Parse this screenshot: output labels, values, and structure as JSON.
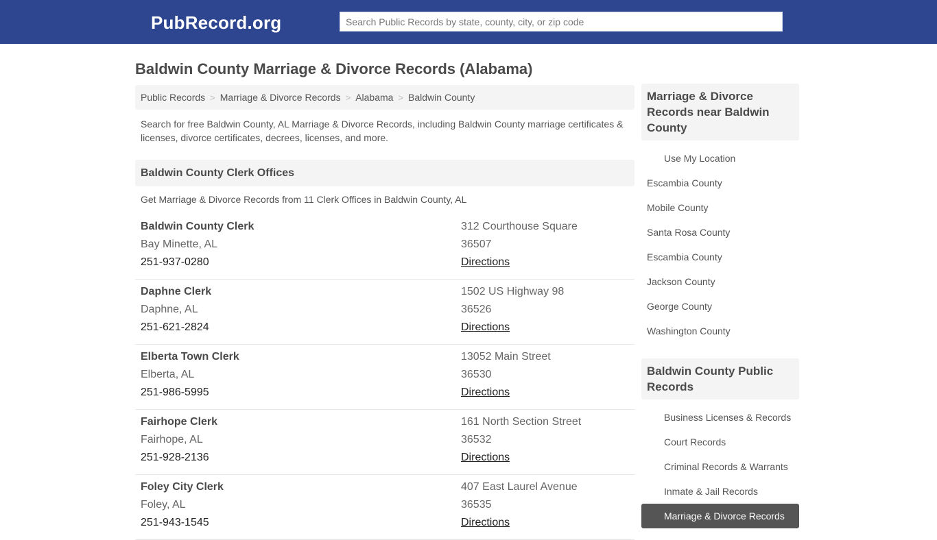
{
  "header": {
    "logo": "PubRecord.org",
    "search_placeholder": "Search Public Records by state, county, city, or zip code",
    "search_value": "",
    "bg_color": "#2e4690"
  },
  "page": {
    "title": "Baldwin County Marriage & Divorce Records (Alabama)",
    "breadcrumb": [
      {
        "label": "Public Records"
      },
      {
        "label": "Marriage & Divorce Records"
      },
      {
        "label": "Alabama"
      },
      {
        "label": "Baldwin County"
      }
    ],
    "breadcrumb_separator": ">",
    "intro": "Search for free Baldwin County, AL Marriage & Divorce Records, including Baldwin County marriage certificates & licenses, divorce certificates, decrees, licenses, and more.",
    "section_title": "Baldwin County Clerk Offices",
    "section_subtitle": "Get Marriage & Divorce Records from 11 Clerk Offices in Baldwin County, AL"
  },
  "offices": [
    {
      "name": "Baldwin County Clerk",
      "city": "Bay Minette, AL",
      "phone": "251-937-0280",
      "address": "312 Courthouse Square",
      "zip": "36507",
      "directions": "Directions"
    },
    {
      "name": "Daphne Clerk",
      "city": "Daphne, AL",
      "phone": "251-621-2824",
      "address": "1502 US Highway 98",
      "zip": "36526",
      "directions": "Directions"
    },
    {
      "name": "Elberta Town Clerk",
      "city": "Elberta, AL",
      "phone": "251-986-5995",
      "address": "13052 Main Street",
      "zip": "36530",
      "directions": "Directions"
    },
    {
      "name": "Fairhope Clerk",
      "city": "Fairhope, AL",
      "phone": "251-928-2136",
      "address": "161 North Section Street",
      "zip": "36532",
      "directions": "Directions"
    },
    {
      "name": "Foley City Clerk",
      "city": "Foley, AL",
      "phone": "251-943-1545",
      "address": "407 East Laurel Avenue",
      "zip": "36535",
      "directions": "Directions"
    }
  ],
  "sidebar": {
    "nearby_title": "Marriage & Divorce Records near Baldwin County",
    "use_location": "Use My Location",
    "nearby": [
      {
        "label": "Escambia County"
      },
      {
        "label": "Mobile County"
      },
      {
        "label": "Santa Rosa County"
      },
      {
        "label": "Escambia County"
      },
      {
        "label": "Jackson County"
      },
      {
        "label": "George County"
      },
      {
        "label": "Washington County"
      }
    ],
    "public_title": "Baldwin County Public Records",
    "public": [
      {
        "label": "Business Licenses & Records",
        "active": false
      },
      {
        "label": "Court Records",
        "active": false
      },
      {
        "label": "Criminal Records & Warrants",
        "active": false
      },
      {
        "label": "Inmate & Jail Records",
        "active": false
      },
      {
        "label": "Marriage & Divorce Records",
        "active": true
      }
    ],
    "active_color": "#555555"
  }
}
